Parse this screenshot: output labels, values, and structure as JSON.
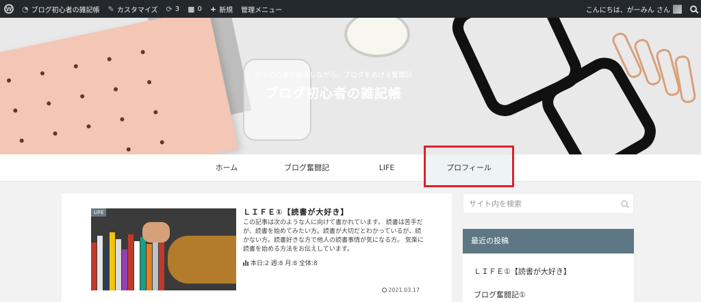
{
  "admin_bar": {
    "site_name": "ブログ初心者の雑記帳",
    "customize": "カスタマイズ",
    "updates_count": "3",
    "comments_count": "0",
    "new": "新規",
    "admin_menu": "管理メニュー",
    "greeting": "こんにちは、がーみん さん"
  },
  "header": {
    "description": "完全初心者が勉強しながら、ブログをあげる奮闘記",
    "title": "ブログ初心者の雑記帳"
  },
  "nav": {
    "items": [
      "ホーム",
      "ブログ奮闘記",
      "LIFE",
      "プロフィール"
    ]
  },
  "post": {
    "category": "LIFE",
    "title": "ＬＩＦＥ①【読書が大好き】",
    "excerpt": "この記事は次のような人に向けて書かれています。 読書は苦手だが、読書を始めてみたい方。読書が大切だとわかっているが、続かない方。読書好きな方で他人の読書事情が気になる方。 気楽に読書を始める方法をお伝えしています。",
    "views": "本日:2 週:8 月:8 全体:8",
    "date": "2021.03.17"
  },
  "sidebar": {
    "search_placeholder": "サイト内を検索",
    "recent_heading": "最近の投稿",
    "recent_posts": [
      "ＬＩＦＥ①【読書が大好き】",
      "ブログ奮闘記①"
    ]
  },
  "colors": {
    "admin_bar": "#23282d",
    "sidebar_heading": "#5e7784",
    "highlight": "#e01e2a"
  }
}
